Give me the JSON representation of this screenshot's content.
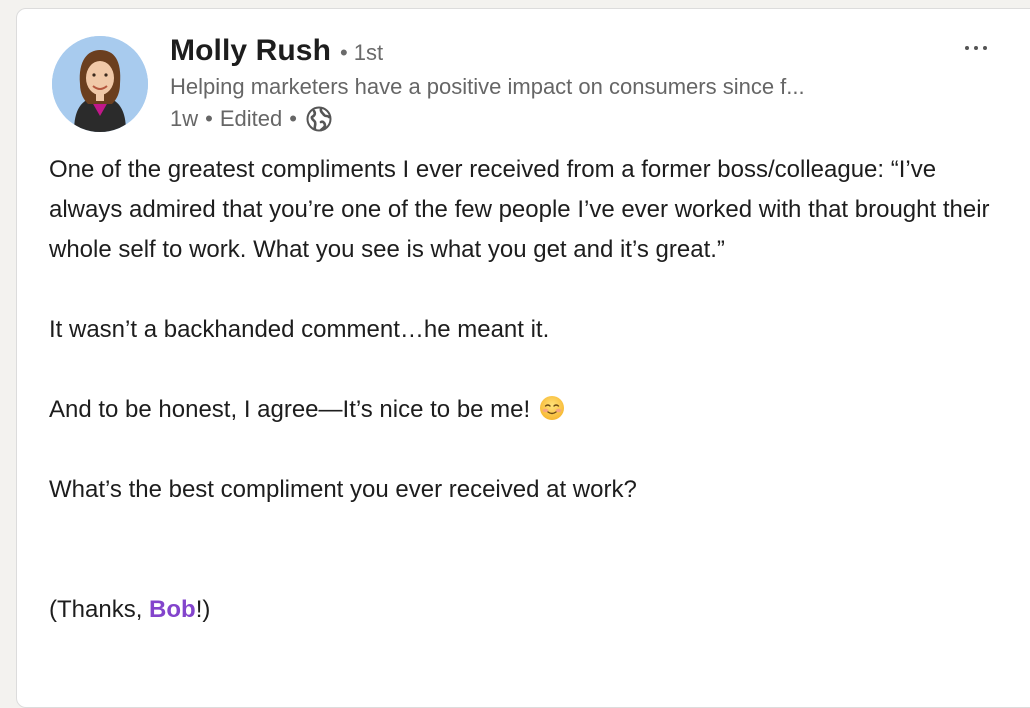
{
  "author": {
    "name": "Molly Rush",
    "degree": "1st",
    "headline": "Helping marketers have a positive impact on consumers since f...",
    "age": "1w",
    "edited": "Edited",
    "visibility_icon": "globe-icon"
  },
  "menu": {
    "icon": "more-options-icon"
  },
  "post": {
    "paragraph_1": "One of the greatest compliments I ever received from a former boss/colleague: “I’ve always admired that you’re one of the few people I’ve ever worked with that brought their whole self to work. What you see is what you get and it’s great.”",
    "paragraph_2": "It wasn’t a backhanded comment…he meant it.",
    "paragraph_3": "And to be honest, I agree—It’s nice to be me!",
    "paragraph_3_emoji": "smiling-face-icon",
    "paragraph_4": "What’s the best compliment you ever received at work?",
    "closing_prefix": "(Thanks, ",
    "closing_mention": "Bob",
    "closing_suffix": "!)"
  },
  "colors": {
    "mention": "#8344cc",
    "text": "#1d1d1d",
    "secondary_text": "#666666"
  }
}
